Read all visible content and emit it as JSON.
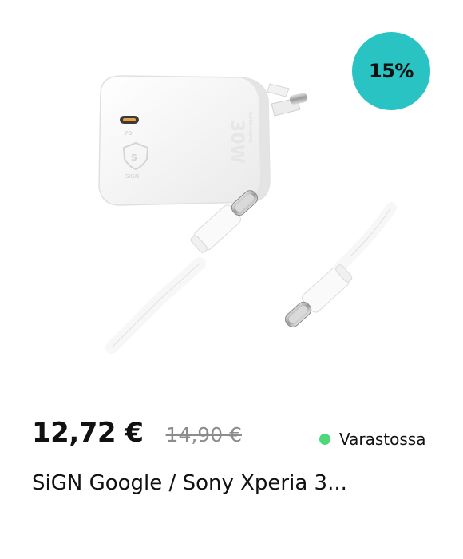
{
  "product": {
    "image_icon": "charger-and-usb-c-cable-image",
    "discount_badge": "15%",
    "price_current": "12,72 €",
    "price_old": "14,90 €",
    "stock_status": "Varastossa",
    "title": "SiGN Google / Sony Xperia 3...",
    "colors": {
      "badge": "#29c3c3",
      "stock_dot": "#4cd97a",
      "old_price": "#8c8c8c"
    }
  }
}
